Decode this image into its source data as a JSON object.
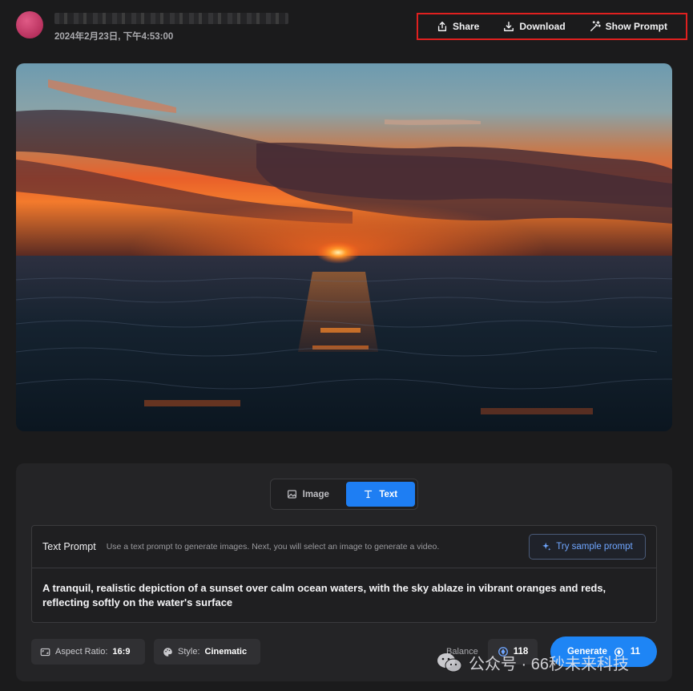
{
  "header": {
    "date": "2024年2月23日, 下午4:53:00",
    "actions": [
      {
        "label": "Share",
        "icon": "share-icon"
      },
      {
        "label": "Download",
        "icon": "download-icon"
      },
      {
        "label": "Show Prompt",
        "icon": "magic-wand-icon"
      }
    ]
  },
  "mode": {
    "image_label": "Image",
    "text_label": "Text",
    "active": "Text"
  },
  "prompt": {
    "title": "Text Prompt",
    "hint": "Use a text prompt to generate images. Next, you will select an image to generate a video.",
    "sample_label": "Try sample prompt",
    "text": "A tranquil, realistic depiction of a sunset over calm ocean waters, with the sky ablaze in vibrant oranges and reds, reflecting softly on the water's surface"
  },
  "options": {
    "aspect_label": "Aspect Ratio:",
    "aspect_value": "16:9",
    "style_label": "Style:",
    "style_value": "Cinematic"
  },
  "balance": {
    "label": "Balance",
    "value": "118"
  },
  "generate": {
    "label": "Generate",
    "cost": "11"
  },
  "watermark": {
    "text": "公众号 · 66秒未来科技"
  },
  "colors": {
    "accent": "#1e85f5",
    "highlight_border": "#e0201f",
    "background": "#1b1b1c"
  }
}
